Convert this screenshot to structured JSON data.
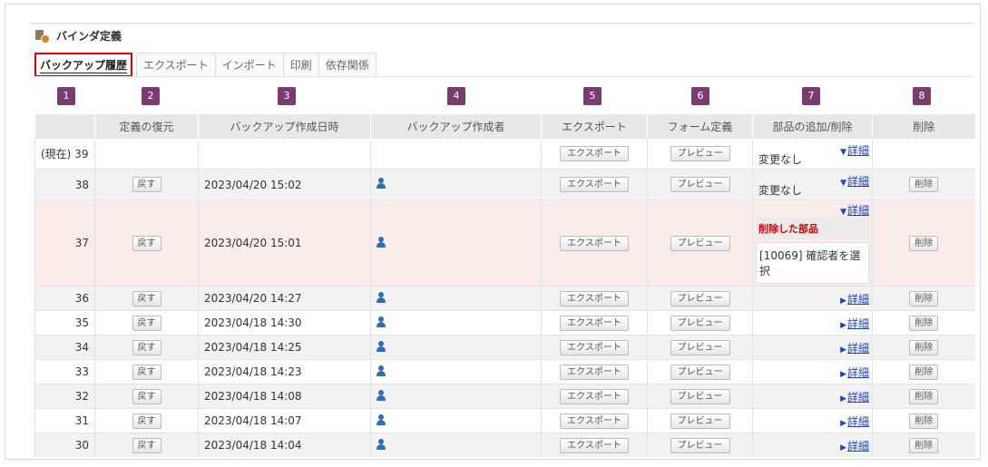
{
  "page_title": "バインダ定義",
  "tabs": [
    "バックアップ履歴",
    "エクスポート",
    "インポート",
    "印刷",
    "依存関係"
  ],
  "badges": [
    "1",
    "2",
    "3",
    "4",
    "5",
    "6",
    "7",
    "8"
  ],
  "columns": [
    "",
    "定義の復元",
    "バックアップ作成日時",
    "バックアップ作成者",
    "エクスポート",
    "フォーム定義",
    "部品の追加/削除",
    "削除"
  ],
  "buttons": {
    "restore": "戻す",
    "export": "エクスポート",
    "preview": "プレビュー",
    "delete": "削除"
  },
  "detail_label": "詳細",
  "no_change": "変更なし",
  "deleted_parts_label": "削除した部品",
  "deleted_item": "[10069] 確認者を選択",
  "rows": [
    {
      "num": "(現在) 39",
      "date": ""
    },
    {
      "num": "38",
      "date": "2023/04/20 15:02"
    },
    {
      "num": "37",
      "date": "2023/04/20 15:01"
    },
    {
      "num": "36",
      "date": "2023/04/20 14:27"
    },
    {
      "num": "35",
      "date": "2023/04/18 14:30"
    },
    {
      "num": "34",
      "date": "2023/04/18 14:25"
    },
    {
      "num": "33",
      "date": "2023/04/18 14:23"
    },
    {
      "num": "32",
      "date": "2023/04/18 14:08"
    },
    {
      "num": "31",
      "date": "2023/04/18 14:07"
    },
    {
      "num": "30",
      "date": "2023/04/18 14:04"
    }
  ],
  "colors": {
    "badge": "#7a3b6e",
    "highlight_row": "#f9ece9",
    "active_tab_border": "#e00000",
    "link": "#1f43c7"
  }
}
